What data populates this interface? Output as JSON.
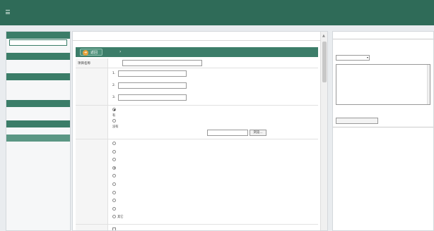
{
  "window": {
    "title": ""
  },
  "sidebar": {
    "items": [
      {
        "type": "head",
        "label": ""
      },
      {
        "type": "active",
        "label": ""
      },
      {
        "type": "item",
        "label": ""
      },
      {
        "type": "head",
        "label": ""
      },
      {
        "type": "item",
        "label": ""
      },
      {
        "type": "item",
        "label": ""
      },
      {
        "type": "head",
        "label": ""
      },
      {
        "type": "item",
        "label": ""
      },
      {
        "type": "item",
        "label": ""
      },
      {
        "type": "item",
        "label": ""
      },
      {
        "type": "head",
        "label": ""
      },
      {
        "type": "item",
        "label": ""
      },
      {
        "type": "item",
        "label": ""
      },
      {
        "type": "head",
        "label": ""
      },
      {
        "type": "item",
        "label": ""
      },
      {
        "type": "head-light",
        "label": ""
      },
      {
        "type": "item",
        "label": ""
      },
      {
        "type": "item",
        "label": ""
      }
    ]
  },
  "main": {
    "section_title": "",
    "back_label": "返回",
    "form": {
      "project_name": {
        "label": "项目名称",
        "value": ""
      },
      "applicant": {
        "label": "",
        "rows": [
          {
            "num": "1.",
            "value": ""
          },
          {
            "num": "2.",
            "value": ""
          },
          {
            "num": "3.",
            "value": ""
          }
        ]
      },
      "overseas": {
        "label": "",
        "options": [
          "有",
          "没有"
        ],
        "selected": 0,
        "upload_label": "",
        "browse_label": "浏览..."
      },
      "direction": {
        "label": "",
        "options": [
          "",
          "",
          "",
          "",
          "",
          "",
          "",
          "",
          "",
          "其它"
        ],
        "selected": 3
      }
    }
  },
  "review": {
    "title": "",
    "hint": "",
    "select_value": "",
    "opinion_text": "",
    "submit_label": "",
    "history_title": ""
  }
}
